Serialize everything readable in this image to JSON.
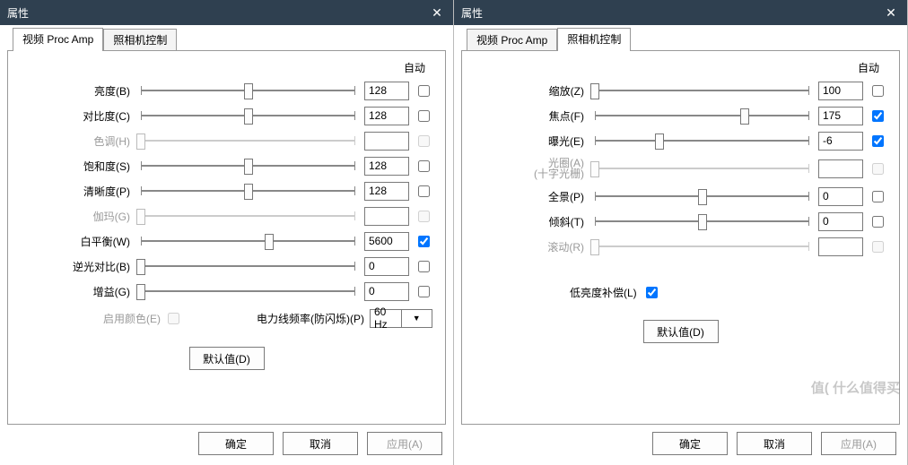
{
  "shared": {
    "window_title": "属性",
    "auto_header": "自动",
    "tabs": {
      "video": "视频 Proc Amp",
      "camera": "照相机控制"
    },
    "buttons": {
      "default": "默认值(D)",
      "ok": "确定",
      "cancel": "取消",
      "apply": "应用(A)"
    }
  },
  "left": {
    "active_tab": "video",
    "rows": [
      {
        "label": "亮度(B)",
        "value": "128",
        "pos": 50,
        "auto": false,
        "disabled": false
      },
      {
        "label": "对比度(C)",
        "value": "128",
        "pos": 50,
        "auto": false,
        "disabled": false
      },
      {
        "label": "色调(H)",
        "value": "",
        "pos": 0,
        "auto": false,
        "disabled": true
      },
      {
        "label": "饱和度(S)",
        "value": "128",
        "pos": 50,
        "auto": false,
        "disabled": false
      },
      {
        "label": "清晰度(P)",
        "value": "128",
        "pos": 50,
        "auto": false,
        "disabled": false
      },
      {
        "label": "伽玛(G)",
        "value": "",
        "pos": 0,
        "auto": false,
        "disabled": true
      },
      {
        "label": "白平衡(W)",
        "value": "5600",
        "pos": 60,
        "auto": true,
        "disabled": false
      },
      {
        "label": "逆光对比(B)",
        "value": "0",
        "pos": 0,
        "auto": false,
        "disabled": false
      },
      {
        "label": "增益(G)",
        "value": "0",
        "pos": 0,
        "auto": false,
        "disabled": false
      }
    ],
    "enable_color_label": "启用颜色(E)",
    "powerline_label": "电力线频率(防闪烁)(P)",
    "powerline_value": "60 Hz"
  },
  "right": {
    "active_tab": "camera",
    "rows": [
      {
        "label": "缩放(Z)",
        "value": "100",
        "pos": 0,
        "auto": false,
        "disabled": false
      },
      {
        "label": "焦点(F)",
        "value": "175",
        "pos": 70,
        "auto": true,
        "disabled": false
      },
      {
        "label": "曝光(E)",
        "value": "-6",
        "pos": 30,
        "auto": true,
        "disabled": false
      },
      {
        "label": "光圈(A)",
        "sublabel": "(十字光栅)",
        "value": "",
        "pos": 0,
        "auto": false,
        "disabled": true
      },
      {
        "label": "全景(P)",
        "value": "0",
        "pos": 50,
        "auto": false,
        "disabled": false
      },
      {
        "label": "倾斜(T)",
        "value": "0",
        "pos": 50,
        "auto": false,
        "disabled": false
      },
      {
        "label": "滚动(R)",
        "value": "",
        "pos": 0,
        "auto": false,
        "disabled": true
      }
    ],
    "lowlight_label": "低亮度补偿(L)",
    "lowlight_checked": true,
    "watermark": "值( 什么值得买"
  }
}
